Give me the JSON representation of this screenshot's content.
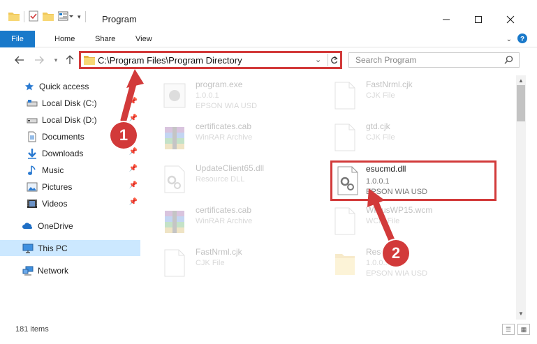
{
  "window": {
    "title": "Program"
  },
  "ribbon": {
    "tabs": [
      "File",
      "Home",
      "Share",
      "View"
    ]
  },
  "address": {
    "path": "C:\\Program Files\\Program Directory"
  },
  "search": {
    "placeholder": "Search Program"
  },
  "sidebar": {
    "quick_access": "Quick access",
    "items": [
      {
        "label": "Local Disk (C:)",
        "icon": "drive-icon"
      },
      {
        "label": "Local Disk (D:)",
        "icon": "drive-icon"
      },
      {
        "label": "Documents",
        "icon": "documents-icon"
      },
      {
        "label": "Downloads",
        "icon": "downloads-icon"
      },
      {
        "label": "Music",
        "icon": "music-icon"
      },
      {
        "label": "Pictures",
        "icon": "pictures-icon"
      },
      {
        "label": "Videos",
        "icon": "videos-icon"
      }
    ],
    "onedrive": "OneDrive",
    "this_pc": "This PC",
    "network": "Network"
  },
  "files": [
    {
      "name": "program.exe",
      "line1": "1.0.0.1",
      "line2": "EPSON WIA USD",
      "icon": "exe-icon"
    },
    {
      "name": "FastNrml.cjk",
      "line1": "CJK File",
      "line2": "",
      "icon": "file-icon"
    },
    {
      "name": "certificates.cab",
      "line1": "WinRAR Archive",
      "line2": "",
      "icon": "archive-icon"
    },
    {
      "name": "gtd.cjk",
      "line1": "CJK File",
      "line2": "",
      "icon": "file-icon"
    },
    {
      "name": "UpdateClient65.dll",
      "line1": "Resource DLL",
      "line2": "",
      "icon": "dll-icon"
    },
    {
      "name": "esucmd.dll",
      "line1": "1.0.0.1",
      "line2": "EPSON WIA USD",
      "icon": "dll-icon"
    },
    {
      "name": "certificates.cab",
      "line1": "WinRAR Archive",
      "line2": "",
      "icon": "archive-icon"
    },
    {
      "name": "WPlusWP15.wcm",
      "line1": "WCM File",
      "line2": "",
      "icon": "file-icon"
    },
    {
      "name": "FastNrml.cjk",
      "line1": "CJK File",
      "line2": "",
      "icon": "file-icon"
    },
    {
      "name": "Resources",
      "line1": "1.0.0.1",
      "line2": "EPSON WIA USD",
      "icon": "folder-icon"
    }
  ],
  "status": {
    "count": "181 items"
  },
  "callouts": [
    "1",
    "2"
  ],
  "colors": {
    "accent": "#1979ca",
    "annotation": "#d23a3a",
    "selection": "#cce8ff"
  }
}
